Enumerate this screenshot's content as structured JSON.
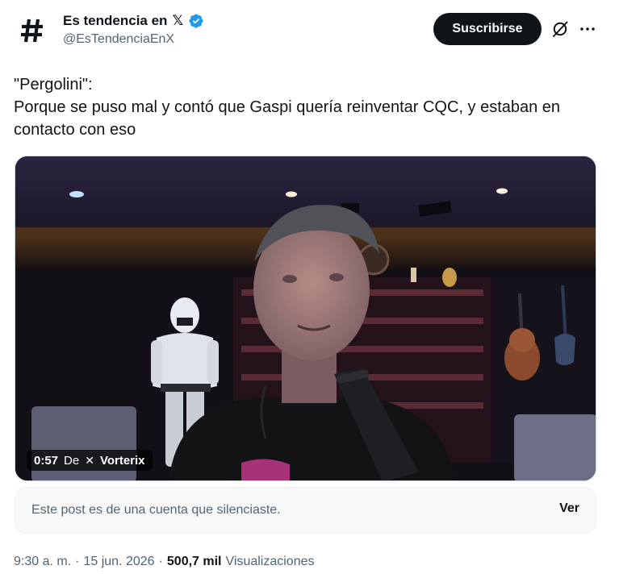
{
  "account": {
    "display_name": "Es tendencia en",
    "name_suffix": "𝕏",
    "handle": "@EsTendenciaEnX",
    "avatar_icon": "hashtag-icon",
    "verified_icon": "verified-badge-icon",
    "verified_color": "#1d9bf0"
  },
  "actions": {
    "subscribe_label": "Suscribirse",
    "grok_icon": "grok-icon",
    "more_icon": "more-options-icon"
  },
  "tweet": {
    "line1": "\"Pergolini\":",
    "line2": "Porque se puso mal y contó que Gaspi quería reinventar CQC, y estaban en",
    "line3": "contacto con eso"
  },
  "media": {
    "duration": "0:57",
    "from_label": "De",
    "source_icon": "x-icon",
    "source_name": "Vorterix"
  },
  "muted_notice": {
    "text": "Este post es de una cuenta que silenciaste.",
    "action_label": "Ver"
  },
  "meta": {
    "time": "9:30 a. m.",
    "separator": "·",
    "date": "15 jun. 2026",
    "separator2": "·",
    "views_count": "500,7 mil",
    "views_label": "Visualizaciones"
  }
}
